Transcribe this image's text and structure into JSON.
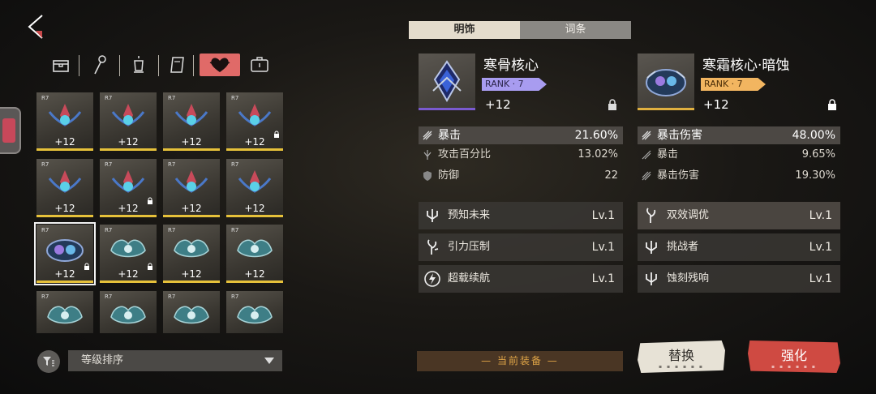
{
  "tabs": [
    {
      "label": "明饰"
    },
    {
      "label": "词条"
    }
  ],
  "categories": [
    {
      "icon": "chest-icon"
    },
    {
      "icon": "scepter-icon"
    },
    {
      "icon": "lantern-icon"
    },
    {
      "icon": "book-icon"
    },
    {
      "icon": "heart-icon",
      "active": true
    },
    {
      "icon": "case-icon"
    }
  ],
  "grid": {
    "rank_label": "R7",
    "level_label": "+12",
    "accent_color": "#e6c13a"
  },
  "sort": {
    "label": "等级排序"
  },
  "current_item": {
    "name": "寒骨核心",
    "rank": "RANK · 7",
    "level": "+12",
    "rank_color": "#a89cf0",
    "stats": [
      {
        "name": "暴击",
        "value": "21.60%"
      },
      {
        "name": "攻击百分比",
        "value": "13.02%"
      },
      {
        "name": "防御",
        "value": "22"
      }
    ],
    "skills": [
      {
        "name": "预知未来",
        "level": "Lv.1"
      },
      {
        "name": "引力压制",
        "level": "Lv.1"
      },
      {
        "name": "超载续航",
        "level": "Lv.1"
      }
    ],
    "equipped_label": "— 当前装备 —"
  },
  "compare_item": {
    "name": "寒霜核心·暗蚀",
    "rank": "RANK · 7",
    "level": "+12",
    "rank_color": "#f2b560",
    "stats": [
      {
        "name": "暴击伤害",
        "value": "48.00%"
      },
      {
        "name": "暴击",
        "value": "9.65%"
      },
      {
        "name": "暴击伤害",
        "value": "19.30%"
      }
    ],
    "skills": [
      {
        "name": "双效调优",
        "level": "Lv.1"
      },
      {
        "name": "挑战者",
        "level": "Lv.1"
      },
      {
        "name": "蚀刻残响",
        "level": "Lv.1"
      }
    ]
  },
  "buttons": {
    "replace": "替换",
    "enhance": "强化"
  }
}
